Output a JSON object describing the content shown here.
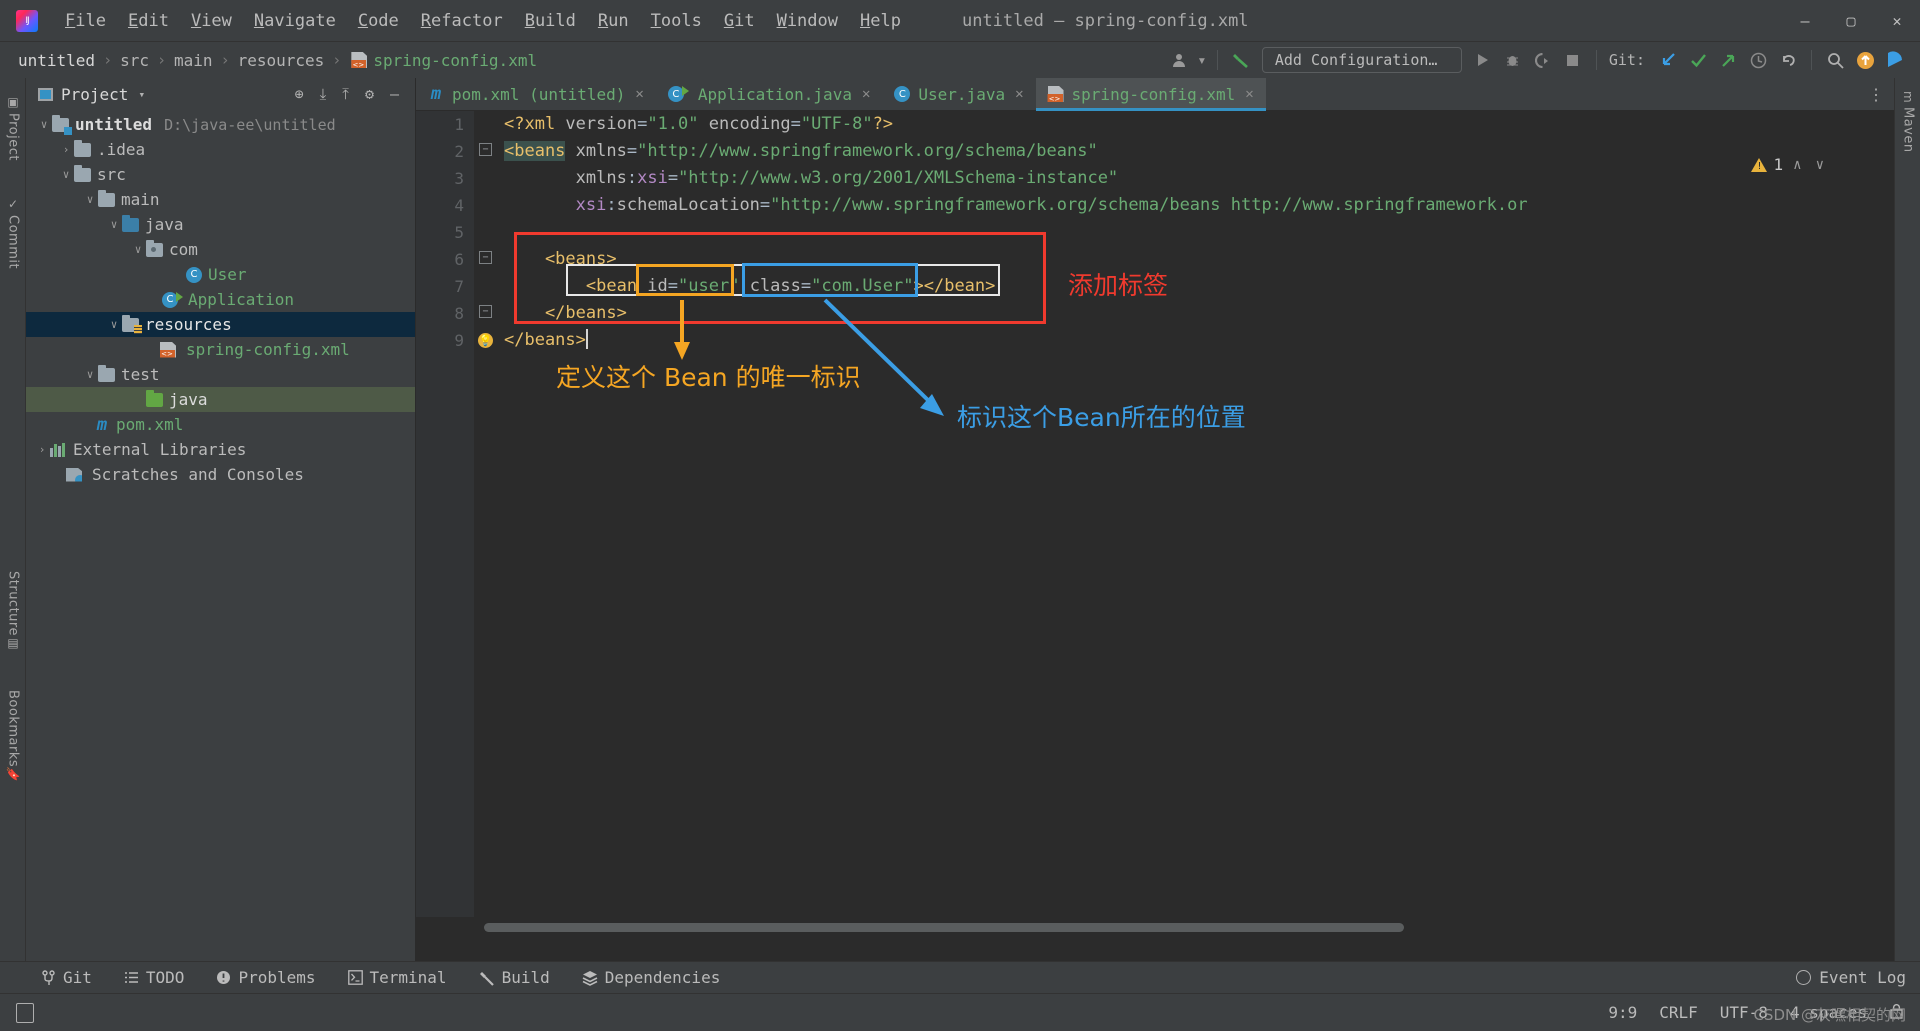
{
  "window": {
    "title": "untitled – spring-config.xml",
    "app_icon": "intellij-logo-icon",
    "minimize": "—",
    "maximize": "▢",
    "close": "✕"
  },
  "menu": {
    "items": [
      "File",
      "Edit",
      "View",
      "Navigate",
      "Code",
      "Refactor",
      "Build",
      "Run",
      "Tools",
      "Git",
      "Window",
      "Help"
    ]
  },
  "breadcrumb": {
    "items": [
      "untitled",
      "src",
      "main",
      "resources",
      "spring-config.xml"
    ],
    "separator": "›"
  },
  "toolbar": {
    "user_icon": "user-account-icon",
    "caret": "▾",
    "build_icon": "build-hammer-icon",
    "run_config": "Add Configuration…",
    "run_icon": "run-play-icon",
    "debug_icon": "debug-bug-icon",
    "coverage_icon": "run-with-coverage-icon",
    "stop_icon": "stop-square-icon",
    "git_label": "Git:",
    "git_update": "update-project-icon",
    "git_commit": "commit-check-icon",
    "git_push": "push-arrow-icon",
    "git_history": "history-clock-icon",
    "git_rollback": "rollback-icon",
    "search_icon": "search-magnifier-icon",
    "updates_icon": "update-available-icon",
    "ide_icon": "ide-feature-icon"
  },
  "left_strip": {
    "items": [
      {
        "label": "Project",
        "icon": "project-icon"
      },
      {
        "label": "Commit",
        "icon": "commit-icon"
      },
      {
        "label": "Structure",
        "icon": "structure-icon"
      },
      {
        "label": "Bookmarks",
        "icon": "bookmarks-icon"
      }
    ]
  },
  "right_strip": {
    "items": [
      {
        "label": "Maven",
        "icon": "maven-icon"
      }
    ]
  },
  "project_panel": {
    "title": "Project",
    "caret": "▾",
    "actions": [
      "locate-target-icon",
      "expand-all-icon",
      "collapse-all-icon",
      "settings-gear-icon",
      "hide-minus-icon"
    ],
    "tree": [
      {
        "label": "untitled",
        "hint": "D:\\java-ee\\untitled",
        "arrow": "∨",
        "icon": "project-folder-icon",
        "indent": 0,
        "style": "bold",
        "selected": ""
      },
      {
        "label": ".idea",
        "hint": "",
        "arrow": "›",
        "icon": "folder-icon",
        "indent": 1,
        "style": "",
        "selected": ""
      },
      {
        "label": "src",
        "hint": "",
        "arrow": "∨",
        "icon": "folder-icon",
        "indent": 1,
        "style": "",
        "selected": ""
      },
      {
        "label": "main",
        "hint": "",
        "arrow": "∨",
        "icon": "folder-icon",
        "indent": 2,
        "style": "",
        "selected": ""
      },
      {
        "label": "java",
        "hint": "",
        "arrow": "∨",
        "icon": "source-folder-icon",
        "indent": 3,
        "style": "",
        "selected": ""
      },
      {
        "label": "com",
        "hint": "",
        "arrow": "∨",
        "icon": "package-folder-icon",
        "indent": 4,
        "style": "",
        "selected": ""
      },
      {
        "label": "User",
        "hint": "",
        "arrow": "",
        "icon": "java-class-icon",
        "indent": 5,
        "style": "green",
        "selected": ""
      },
      {
        "label": "Application",
        "hint": "",
        "arrow": "",
        "icon": "java-runnable-class-icon",
        "indent": 4,
        "style": "green",
        "selected": ""
      },
      {
        "label": "resources",
        "hint": "",
        "arrow": "∨",
        "icon": "resources-folder-icon",
        "indent": 3,
        "style": "",
        "selected": "blue"
      },
      {
        "label": "spring-config.xml",
        "hint": "",
        "arrow": "",
        "icon": "xml-file-icon",
        "indent": 4,
        "style": "green",
        "selected": ""
      },
      {
        "label": "test",
        "hint": "",
        "arrow": "∨",
        "icon": "folder-icon",
        "indent": 2,
        "style": "",
        "selected": ""
      },
      {
        "label": "java",
        "hint": "",
        "arrow": "",
        "icon": "test-source-folder-icon",
        "indent": 3,
        "style": "",
        "selected": "green"
      },
      {
        "label": "pom.xml",
        "hint": "",
        "arrow": "",
        "icon": "maven-pom-icon",
        "indent": 1,
        "style": "green",
        "selected": ""
      },
      {
        "label": "External Libraries",
        "hint": "",
        "arrow": "›",
        "icon": "libraries-icon",
        "indent": 0,
        "style": "",
        "selected": ""
      },
      {
        "label": "Scratches and Consoles",
        "hint": "",
        "arrow": "",
        "icon": "scratches-icon",
        "indent": 0,
        "style": "",
        "selected": ""
      }
    ]
  },
  "editor": {
    "tabs": [
      {
        "label": "pom.xml (untitled)",
        "icon": "maven-pom-icon",
        "close": "✕",
        "active": false
      },
      {
        "label": "Application.java",
        "icon": "java-runnable-class-icon",
        "close": "✕",
        "active": false
      },
      {
        "label": "User.java",
        "icon": "java-class-icon",
        "close": "✕",
        "active": false
      },
      {
        "label": "spring-config.xml",
        "icon": "xml-file-icon",
        "close": "✕",
        "active": true
      }
    ],
    "tab_overflow": "⋮",
    "line_numbers": [
      "1",
      "2",
      "3",
      "4",
      "5",
      "6",
      "7",
      "8",
      "9"
    ],
    "inspection_count": "1",
    "inspection_up": "∧",
    "inspection_down": "∨",
    "lines": [
      {
        "n": 1,
        "segments": [
          {
            "t": "<?xml ",
            "c": "t-tag"
          },
          {
            "t": "version",
            "c": "t-attr"
          },
          {
            "t": "=",
            "c": "t-eq"
          },
          {
            "t": "\"1.0\"",
            "c": "t-str"
          },
          {
            "t": " ",
            "c": "t-plain"
          },
          {
            "t": "encoding",
            "c": "t-attr"
          },
          {
            "t": "=",
            "c": "t-eq"
          },
          {
            "t": "\"UTF-8\"",
            "c": "t-str"
          },
          {
            "t": "?>",
            "c": "t-tag"
          }
        ]
      },
      {
        "n": 2,
        "segments": [
          {
            "t": "<beans",
            "c": "hl-tag"
          },
          {
            "t": " ",
            "c": "t-plain"
          },
          {
            "t": "xmlns",
            "c": "t-attr"
          },
          {
            "t": "=",
            "c": "t-eq"
          },
          {
            "t": "\"http://www.springframework.org/schema/beans\"",
            "c": "t-str"
          }
        ]
      },
      {
        "n": 3,
        "segments": [
          {
            "t": "       ",
            "c": "t-plain"
          },
          {
            "t": "xmlns",
            "c": "t-attr"
          },
          {
            "t": ":",
            "c": "t-eq"
          },
          {
            "t": "xsi",
            "c": "t-ns"
          },
          {
            "t": "=",
            "c": "t-eq"
          },
          {
            "t": "\"http://www.w3.org/2001/XMLSchema-instance\"",
            "c": "t-str"
          }
        ]
      },
      {
        "n": 4,
        "segments": [
          {
            "t": "       ",
            "c": "t-plain"
          },
          {
            "t": "xsi",
            "c": "t-ns"
          },
          {
            "t": ":",
            "c": "t-eq"
          },
          {
            "t": "schemaLocation",
            "c": "t-attr"
          },
          {
            "t": "=",
            "c": "t-eq"
          },
          {
            "t": "\"http://www.springframework.org/schema/beans http://www.springframework.or",
            "c": "t-str"
          }
        ]
      },
      {
        "n": 5,
        "segments": []
      },
      {
        "n": 6,
        "segments": [
          {
            "t": "    <beans>",
            "c": "t-tag"
          }
        ]
      },
      {
        "n": 7,
        "segments": [
          {
            "t": "        <bean ",
            "c": "t-tag"
          },
          {
            "t": "id",
            "c": "t-attr"
          },
          {
            "t": "=",
            "c": "t-eq"
          },
          {
            "t": "\"user\"",
            "c": "t-str"
          },
          {
            "t": " ",
            "c": "t-plain"
          },
          {
            "t": "class",
            "c": "t-attr"
          },
          {
            "t": "=",
            "c": "t-eq"
          },
          {
            "t": "\"com.User\"",
            "c": "t-str"
          },
          {
            "t": "></bean>",
            "c": "t-tag"
          }
        ]
      },
      {
        "n": 8,
        "segments": [
          {
            "t": "    </beans>",
            "c": "t-tag"
          }
        ]
      },
      {
        "n": 9,
        "segments": [
          {
            "t": "</beans>",
            "c": "t-tag"
          }
        ]
      }
    ]
  },
  "annotations": [
    {
      "id": "red-box",
      "kind": "box",
      "color": "#f03a2e",
      "label": ""
    },
    {
      "id": "orange-box",
      "kind": "box",
      "color": "#f5a623",
      "label": ""
    },
    {
      "id": "blue-box",
      "kind": "box",
      "color": "#3b9ee5",
      "label": ""
    },
    {
      "id": "white-box",
      "kind": "box",
      "color": "#e8e8e8",
      "label": ""
    }
  ],
  "annotation_text": {
    "add_tag": "添加标签",
    "define_bean_id": "定义这个 Bean 的唯一标识",
    "bean_location": "标识这个Bean所在的位置"
  },
  "bottom_bar": {
    "items": [
      {
        "label": "Git",
        "icon": "git-branch-icon"
      },
      {
        "label": "TODO",
        "icon": "todo-list-icon"
      },
      {
        "label": "Problems",
        "icon": "problems-icon"
      },
      {
        "label": "Terminal",
        "icon": "terminal-icon"
      },
      {
        "label": "Build",
        "icon": "build-hammer-icon"
      },
      {
        "label": "Dependencies",
        "icon": "dependencies-layers-icon"
      }
    ],
    "event_log": "Event Log",
    "event_log_icon": "event-log-icon"
  },
  "status_bar": {
    "layout_icon": "layout-toggle-icon",
    "caret_position": "9:9",
    "line_separator": "CRLF",
    "encoding": "UTF-8",
    "indent": "4 spaces",
    "lock_icon": "read-only-lock-icon",
    "watermark": "CSDN @灰嘿相契的网"
  },
  "colors": {
    "accent": "#3592c4",
    "string_green": "#6aab73",
    "tag_yellow": "#e8bf6a",
    "anno_red": "#f03a2e",
    "anno_orange": "#f5a623",
    "anno_blue": "#3b9ee5",
    "panel_bg": "#3c3f41",
    "editor_bg": "#2b2b2b"
  }
}
